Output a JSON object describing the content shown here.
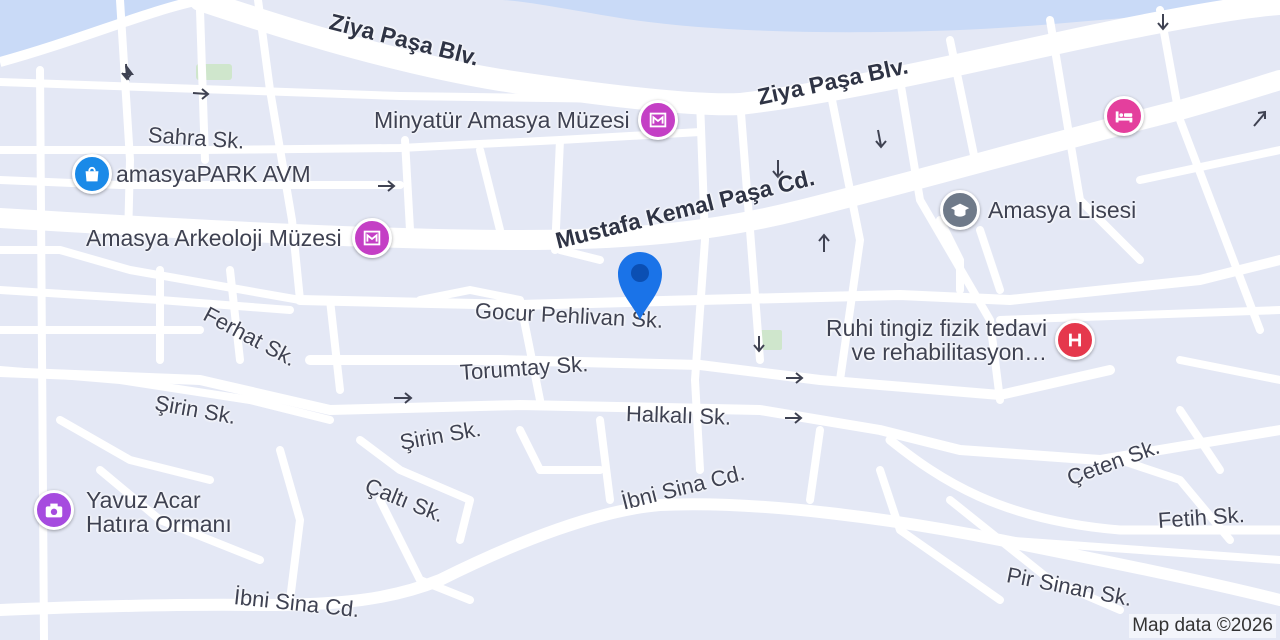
{
  "map": {
    "colors": {
      "land": "#e4e8f5",
      "water": "#c9daf7",
      "road": "#ffffff",
      "park": "#cfe6cc"
    },
    "roads": {
      "ziya_pasa_1": "Ziya Paşa Blv.",
      "ziya_pasa_2": "Ziya Paşa Blv.",
      "mustafa_kemal": "Mustafa Kemal Paşa Cd.",
      "sahra": "Sahra Sk.",
      "ferhat": "Ferhat Sk.",
      "gocur": "Gocur Pehlivan Sk.",
      "torumtay": "Torumtay Sk.",
      "sirin_1": "Şirin Sk.",
      "sirin_2": "Şirin Sk.",
      "halkali": "Halkalı Sk.",
      "calti": "Çaltı Sk.",
      "ibni_sina_1": "İbni Sina Cd.",
      "ibni_sina_2": "İbni Sina Cd.",
      "ceten": "Çeten Sk.",
      "fetih": "Fetih Sk.",
      "pir_sinan": "Pir Sinan Sk."
    },
    "pois": {
      "minyatur": {
        "label": "Minyatür Amasya Müzesi",
        "icon": "museum-icon",
        "color": "#c43fc5"
      },
      "amasyapark": {
        "label": "amasyaPARK AVM",
        "icon": "shopping-bag-icon",
        "color": "#1a8ae8"
      },
      "arkeoloji": {
        "label": "Amasya Arkeoloji Müzesi",
        "icon": "museum-icon",
        "color": "#c43fc5"
      },
      "lisesi": {
        "label": "Amasya Lisesi",
        "icon": "school-icon",
        "color": "#6f7a89"
      },
      "hotel": {
        "label": "",
        "icon": "hotel-bed-icon",
        "color": "#e43f9d"
      },
      "ruhi": {
        "label": "Ruhi tingiz fizik tedavi ve rehabilitasyon…",
        "line1": "Ruhi tingiz fizik tedavi",
        "line2": "ve rehabilitasyon…",
        "icon": "hospital-icon",
        "color": "#e5384c"
      },
      "yavuz": {
        "label": "Yavuz Acar Hatıra Ormanı",
        "line1": "Yavuz Acar",
        "line2": "Hatıra Ormanı",
        "icon": "camera-icon",
        "color": "#a64bdf"
      }
    },
    "marker": {
      "icon": "location-pin-icon",
      "color": "#1a73e8"
    },
    "attribution": "Map data ©2026"
  }
}
